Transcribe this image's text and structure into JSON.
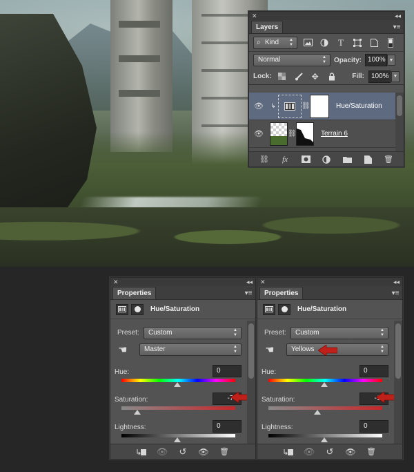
{
  "layers_panel": {
    "tab": "Layers",
    "filter_kind": "Kind",
    "blend_mode": "Normal",
    "opacity_label": "Opacity:",
    "opacity_value": "100%",
    "lock_label": "Lock:",
    "fill_label": "Fill:",
    "fill_value": "100%",
    "layers": [
      {
        "name": "Hue/Saturation",
        "selected": true
      },
      {
        "name": "Terrain 6",
        "selected": false
      }
    ]
  },
  "properties_panels": [
    {
      "tab": "Properties",
      "title": "Hue/Saturation",
      "preset_label": "Preset:",
      "preset_value": "Custom",
      "channel_value": "Master",
      "hue_label": "Hue:",
      "hue_value": "0",
      "saturation_label": "Saturation:",
      "saturation_value": "-72",
      "lightness_label": "Lightness:",
      "lightness_value": "0",
      "saturation_knob": 0.14
    },
    {
      "tab": "Properties",
      "title": "Hue/Saturation",
      "preset_label": "Preset:",
      "preset_value": "Custom",
      "channel_value": "Yellows",
      "hue_label": "Hue:",
      "hue_value": "0",
      "saturation_label": "Saturation:",
      "saturation_value": "-14",
      "lightness_label": "Lightness:",
      "lightness_value": "0",
      "saturation_knob": 0.43
    }
  ],
  "colors": {
    "panel_bg": "#535353",
    "selected_layer": "#5d6a7f",
    "annotation_arrow": "#c0201a"
  }
}
